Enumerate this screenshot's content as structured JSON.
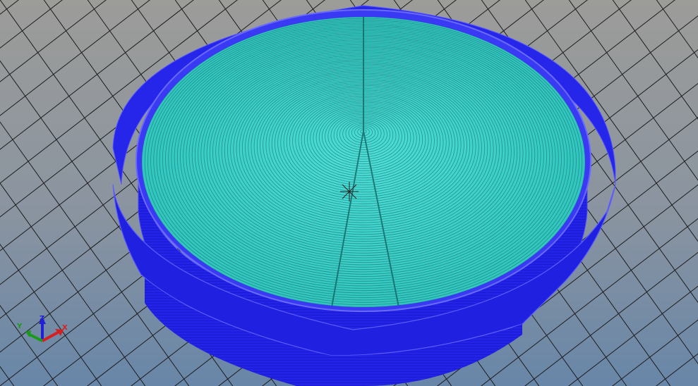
{
  "viewport": {
    "background_top": "#9a9a98",
    "background_bottom": "#6f8aa8",
    "grid_color": "#1a1a1a"
  },
  "model": {
    "wall_color": "#1f1fe6",
    "wall_highlight": "#5a5aff",
    "top_surface_color": "#35d0c8",
    "top_line_color": "#1a6e70"
  },
  "axis_indicator": {
    "x_label": "X",
    "y_label": "Y",
    "z_label": "Z",
    "x_color": "#d42020",
    "y_color": "#1a9a1a",
    "z_color": "#2020d4"
  }
}
